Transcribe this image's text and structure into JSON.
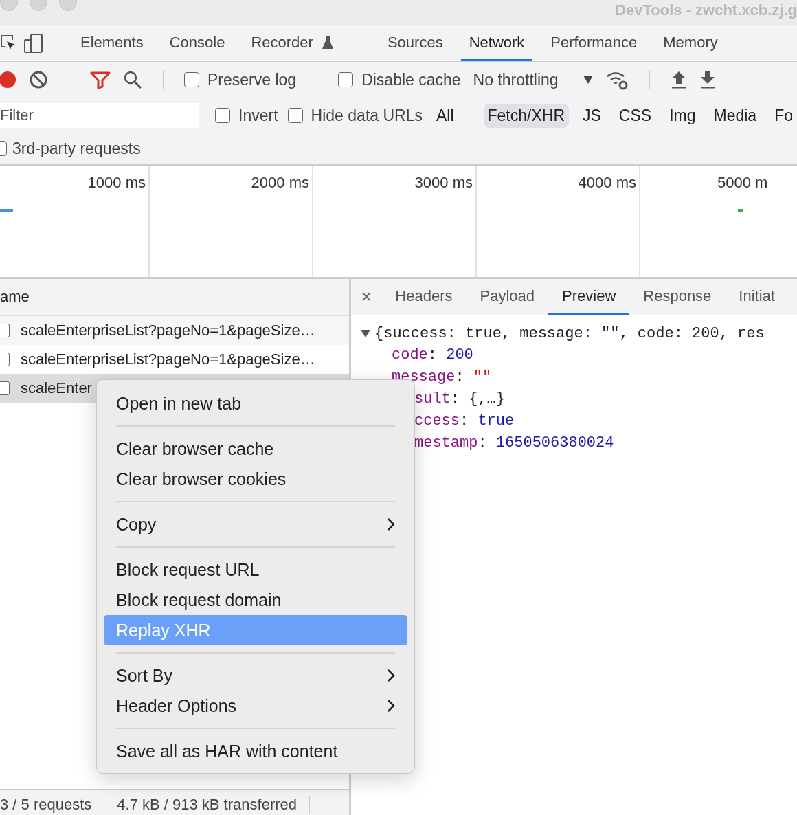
{
  "window": {
    "title": "DevTools - zwcht.xcb.zj.g"
  },
  "panel_tabs": [
    {
      "label": "Elements",
      "selected": false,
      "icon": false
    },
    {
      "label": "Console",
      "selected": false,
      "icon": false
    },
    {
      "label": "Recorder",
      "selected": false,
      "icon": true
    },
    {
      "label": "Sources",
      "selected": false,
      "icon": false
    },
    {
      "label": "Network",
      "selected": true,
      "icon": false
    },
    {
      "label": "Performance",
      "selected": false,
      "icon": false
    },
    {
      "label": "Memory",
      "selected": false,
      "icon": false
    }
  ],
  "toolbar": {
    "recording": true,
    "preserve_log": {
      "label": "Preserve log",
      "checked": false
    },
    "disable_cache": {
      "label": "Disable cache",
      "checked": false
    },
    "throttling": "No throttling"
  },
  "filter": {
    "placeholder": "Filter",
    "invert": {
      "label": "Invert",
      "checked": false
    },
    "hide_data_urls": {
      "label": "Hide data URLs",
      "checked": false
    },
    "types": [
      {
        "label": "All",
        "selected": false
      },
      {
        "label": "Fetch/XHR",
        "selected": true
      },
      {
        "label": "JS",
        "selected": false
      },
      {
        "label": "CSS",
        "selected": false
      },
      {
        "label": "Img",
        "selected": false
      },
      {
        "label": "Media",
        "selected": false
      },
      {
        "label": "Fo",
        "selected": false
      }
    ],
    "third_party": {
      "label": "3rd-party requests",
      "checked": false
    }
  },
  "timeline": {
    "ticks": [
      "1000 ms",
      "2000 ms",
      "3000 ms",
      "4000 ms",
      "5000 m"
    ]
  },
  "requests": {
    "header": "ame",
    "rows": [
      {
        "name": "scaleEnterpriseList?pageNo=1&pageSize…",
        "selected": false,
        "checked": false
      },
      {
        "name": "scaleEnterpriseList?pageNo=1&pageSize…",
        "selected": false,
        "checked": false
      },
      {
        "name": "scaleEnter",
        "selected": true,
        "checked": false
      }
    ]
  },
  "status_bar": [
    "3 / 5 requests",
    "4.7 kB / 913 kB transferred"
  ],
  "detail_tabs": {
    "close": "×",
    "tabs": [
      {
        "label": "Headers",
        "selected": false
      },
      {
        "label": "Payload",
        "selected": false
      },
      {
        "label": "Preview",
        "selected": true
      },
      {
        "label": "Response",
        "selected": false
      },
      {
        "label": "Initiat",
        "selected": false
      }
    ]
  },
  "preview": {
    "summary": "{success: true, message: \"\", code: 200, res",
    "expanded": true,
    "properties": [
      {
        "key": "code",
        "colon": ":",
        "value": "200",
        "kind": "number",
        "clipped": false
      },
      {
        "key": "message",
        "colon": ":",
        "value": "\"\"",
        "kind": "string",
        "clipped": false
      },
      {
        "key": "sult",
        "colon": ":",
        "value": "{,…}",
        "kind": "object",
        "clipped": true
      },
      {
        "key": "ccess",
        "colon": ":",
        "value": "true",
        "kind": "boolean",
        "clipped": true
      },
      {
        "key": "mestamp",
        "colon": ":",
        "value": "1650506380024",
        "kind": "number",
        "clipped": true
      }
    ]
  },
  "context_menu": [
    {
      "kind": "item",
      "label": "Open in new tab",
      "selected": false
    },
    {
      "kind": "separator"
    },
    {
      "kind": "item",
      "label": "Clear browser cache",
      "selected": false
    },
    {
      "kind": "item",
      "label": "Clear browser cookies",
      "selected": false
    },
    {
      "kind": "separator"
    },
    {
      "kind": "submenu",
      "label": "Copy",
      "selected": false
    },
    {
      "kind": "separator"
    },
    {
      "kind": "item",
      "label": "Block request URL",
      "selected": false
    },
    {
      "kind": "item",
      "label": "Block request domain",
      "selected": false
    },
    {
      "kind": "item",
      "label": "Replay XHR",
      "selected": true
    },
    {
      "kind": "separator"
    },
    {
      "kind": "submenu",
      "label": "Sort By",
      "selected": false
    },
    {
      "kind": "submenu",
      "label": "Header Options",
      "selected": false
    },
    {
      "kind": "separator"
    },
    {
      "kind": "item",
      "label": "Save all as HAR with content",
      "selected": false
    }
  ]
}
